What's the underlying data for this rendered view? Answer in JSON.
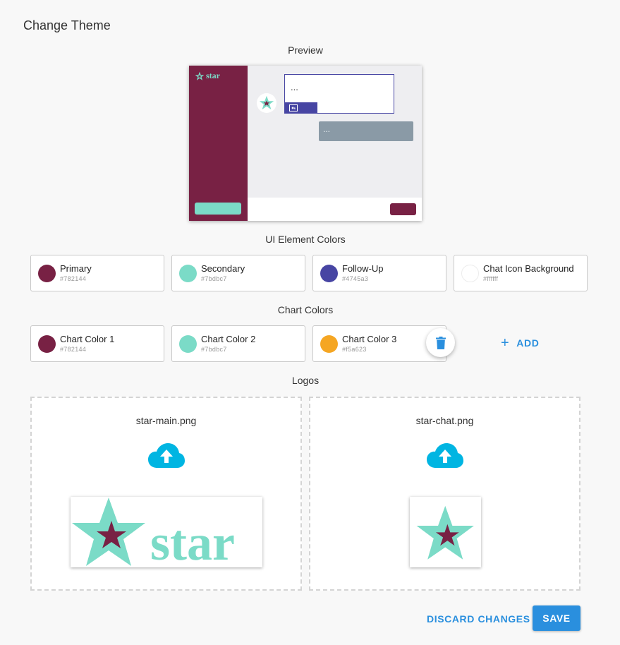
{
  "page": {
    "title": "Change Theme"
  },
  "preview": {
    "title": "Preview",
    "logo_text": "star",
    "message_text": "...",
    "reply_text": "...",
    "colors": {
      "primary": "#782144",
      "secondary": "#7bdbc7",
      "follow_up": "#4745a3",
      "chat_icon_background": "#ffffff"
    }
  },
  "ui_colors": {
    "title": "UI Element Colors",
    "items": [
      {
        "label": "Primary",
        "hex": "#782144"
      },
      {
        "label": "Secondary",
        "hex": "#7bdbc7"
      },
      {
        "label": "Follow-Up",
        "hex": "#4745a3"
      },
      {
        "label": "Chat Icon Background",
        "hex": "#ffffff"
      }
    ]
  },
  "chart_colors": {
    "title": "Chart Colors",
    "items": [
      {
        "label": "Chart Color 1",
        "hex": "#782144"
      },
      {
        "label": "Chart Color 2",
        "hex": "#7bdbc7"
      },
      {
        "label": "Chart Color 3",
        "hex": "#f5a623"
      }
    ],
    "delete_icon": "trash-icon",
    "add_label": "ADD",
    "add_icon": "plus-icon"
  },
  "logos": {
    "title": "Logos",
    "items": [
      {
        "filename": "star-main.png",
        "upload_icon": "cloud-upload-icon",
        "image_text": "star"
      },
      {
        "filename": "star-chat.png",
        "upload_icon": "cloud-upload-icon"
      }
    ]
  },
  "actions": {
    "discard_label": "DISCARD CHANGES",
    "save_label": "SAVE"
  },
  "accent": {
    "primary_button": "#2a8fde",
    "upload_icon_color": "#00b5e2"
  }
}
